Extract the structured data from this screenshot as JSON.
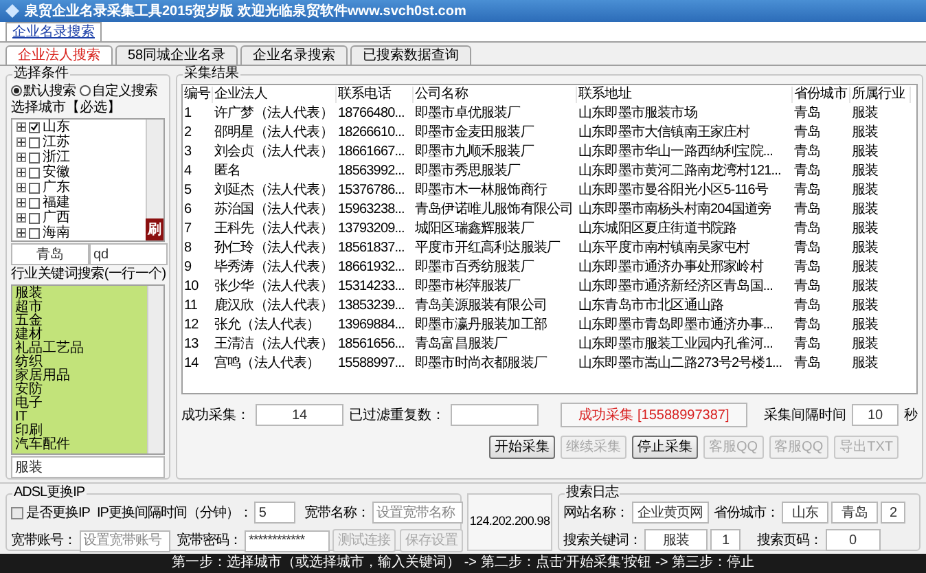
{
  "window": {
    "title": "泉贸企业名录采集工具2015贺岁版 欢迎光临泉贸软件www.svch0st.com"
  },
  "top_tab": "企业名录搜索",
  "tabs": [
    {
      "label": "企业法人搜索",
      "selected": true
    },
    {
      "label": "58同城企业名录",
      "selected": false
    },
    {
      "label": "企业名录搜索",
      "selected": false
    },
    {
      "label": "已搜索数据查询",
      "selected": false
    }
  ],
  "conditions": {
    "title": "选择条件",
    "modes": [
      {
        "label": "默认搜索",
        "selected": true
      },
      {
        "label": "自定义搜索",
        "selected": false
      }
    ],
    "city_label": "选择城市【必选】",
    "cities": [
      {
        "name": "山东",
        "checked": true
      },
      {
        "name": "江苏",
        "checked": false
      },
      {
        "name": "浙江",
        "checked": false
      },
      {
        "name": "安徽",
        "checked": false
      },
      {
        "name": "广东",
        "checked": false
      },
      {
        "name": "福建",
        "checked": false
      },
      {
        "name": "广西",
        "checked": false
      },
      {
        "name": "海南",
        "checked": false
      }
    ],
    "refresh_button": "刷",
    "city_field": "青岛",
    "code_field": "qd",
    "keyword_label": "行业关键词搜索(一行一个)",
    "keywords": [
      "服装",
      "超市",
      "五金",
      "建材",
      "礼品工艺品",
      "纺织",
      "家居用品",
      "安防",
      "电子",
      "IT",
      "印刷",
      "汽车配件"
    ],
    "keyword_field": "服装"
  },
  "results": {
    "title": "采集结果",
    "columns": [
      "编号",
      "企业法人",
      "联系电话",
      "公司名称",
      "联系地址",
      "省份城市",
      "所属行业"
    ],
    "rows": [
      [
        "1",
        "许广梦（法人代表）",
        "18766480...",
        "即墨市卓优服装厂",
        "山东即墨市服装市场",
        "青岛",
        "服装"
      ],
      [
        "2",
        "邵明星（法人代表）",
        "18266610...",
        "即墨市金麦田服装厂",
        "山东即墨市大信镇南王家庄村",
        "青岛",
        "服装"
      ],
      [
        "3",
        "刘会贞（法人代表）",
        "18661667...",
        "即墨市九顺禾服装厂",
        "山东即墨市华山一路西纳利宝院...",
        "青岛",
        "服装"
      ],
      [
        "4",
        "匿名",
        "18563992...",
        "即墨市秀思服装厂",
        "山东即墨市黄河二路南龙湾村121...",
        "青岛",
        "服装"
      ],
      [
        "5",
        "刘延杰（法人代表）",
        "15376786...",
        "即墨市木一林服饰商行",
        "山东即墨市曼谷阳光小区5-116号",
        "青岛",
        "服装"
      ],
      [
        "6",
        "苏治国（法人代表）",
        "15963238...",
        "青岛伊诺唯儿服饰有限公司",
        "山东即墨市南杨头村南204国道旁",
        "青岛",
        "服装"
      ],
      [
        "7",
        "王科先（法人代表）",
        "13793209...",
        "城阳区瑞鑫辉服装厂",
        "山东城阳区夏庄街道书院路",
        "青岛",
        "服装"
      ],
      [
        "8",
        "孙仁玲（法人代表）",
        "18561837...",
        "平度市开红高利达服装厂",
        "山东平度市南村镇南吴家屯村",
        "青岛",
        "服装"
      ],
      [
        "9",
        "毕秀涛（法人代表）",
        "18661932...",
        "即墨市百秀纺服装厂",
        "山东即墨市通济办事处邢家岭村",
        "青岛",
        "服装"
      ],
      [
        "10",
        "张少华（法人代表）",
        "15314233...",
        "即墨市彬萍服装厂",
        "山东即墨市通济新经济区青岛国...",
        "青岛",
        "服装"
      ],
      [
        "11",
        "鹿汉欣（法人代表）",
        "13853239...",
        "青岛美源服装有限公司",
        "山东青岛市市北区通山路",
        "青岛",
        "服装"
      ],
      [
        "12",
        "张允（法人代表）",
        "13969884...",
        "即墨市瀛丹服装加工部",
        "山东即墨市青岛即墨市通济办事...",
        "青岛",
        "服装"
      ],
      [
        "13",
        "王清洁（法人代表）",
        "18561656...",
        "青岛富昌服装厂",
        "山东即墨市服装工业园内孔雀河...",
        "青岛",
        "服装"
      ],
      [
        "14",
        "宫鸣（法人代表）",
        "15588997...",
        "即墨市时尚衣都服装厂",
        "山东即墨市嵩山二路273号2号楼1...",
        "青岛",
        "服装"
      ]
    ]
  },
  "stats": {
    "success_label": "成功采集：",
    "success_value": "14",
    "filtered_label": "已过滤重复数：",
    "status_message": "成功采集 [15588997387]",
    "interval_label": "采集间隔时间",
    "interval_value": "10",
    "interval_unit": "秒"
  },
  "buttons": [
    {
      "label": "开始采集",
      "disabled": false
    },
    {
      "label": "继续采集",
      "disabled": true
    },
    {
      "label": "停止采集",
      "disabled": false
    },
    {
      "label": "客服QQ",
      "disabled": true
    },
    {
      "label": "客服QQ",
      "disabled": true
    },
    {
      "label": "导出TXT",
      "disabled": true
    }
  ],
  "adsl": {
    "title": "ADSL更换IP",
    "change_ip": {
      "label": "是否更换IP",
      "checked": false
    },
    "interval_label": "IP更换间隔时间（分钟）：",
    "interval_value": "5",
    "name_label": "宽带名称：",
    "name_placeholder": "设置宽带名称",
    "account_label": "宽带账号：",
    "account_placeholder": "设置宽带账号",
    "password_label": "宽带密码：",
    "password_value": "************",
    "test_button": "测试连接",
    "save_button": "保存设置"
  },
  "ip": "124.202.200.98",
  "log": {
    "title": "搜索日志",
    "site_label": "网站名称：",
    "site_value": "企业黄页网",
    "city_label": "省份城市：",
    "province": "山东",
    "city": "青岛",
    "city_count": "2",
    "keyword_label": "搜索关键词：",
    "keyword_value": "服装",
    "keyword_count": "1",
    "page_label": "搜索页码：",
    "page_value": "0"
  },
  "status_bar": "第一步：选择城市（或选择城市，输入关键词） -> 第二步：点击‘开始采集’按钮 -> 第三步：停止"
}
